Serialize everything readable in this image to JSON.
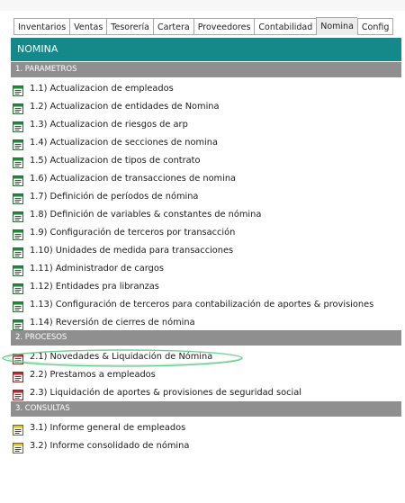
{
  "tabs": [
    {
      "label": "Inventarios",
      "active": false
    },
    {
      "label": "Ventas",
      "active": false
    },
    {
      "label": "Tesorería",
      "active": false
    },
    {
      "label": "Cartera",
      "active": false
    },
    {
      "label": "Proveedores",
      "active": false
    },
    {
      "label": "Contabilidad",
      "active": false
    },
    {
      "label": "Nomina",
      "active": true
    },
    {
      "label": "Config",
      "active": false
    }
  ],
  "header": {
    "title": "NOMINA"
  },
  "colors": {
    "header_bg": "#15898a",
    "section_bg": "#8f8f8f",
    "highlight_oval": "#3fbf6f"
  },
  "sections": [
    {
      "title": "1. PARAMETROS",
      "items": [
        {
          "label": "1.1) Actualizacion de empleados",
          "icon": "green-form-icon"
        },
        {
          "label": "1.2) Actualizacion de entidades de Nomina",
          "icon": "green-form-icon"
        },
        {
          "label": "1.3) Actualizacion de riesgos de arp",
          "icon": "green-form-icon"
        },
        {
          "label": "1.4) Actualizacion de secciones de nomina",
          "icon": "green-form-icon"
        },
        {
          "label": "1.5) Actualizacion de tipos de contrato",
          "icon": "green-form-icon"
        },
        {
          "label": "1.6) Actualizacion de transacciones de nomina",
          "icon": "green-form-icon"
        },
        {
          "label": "1.7) Definición de períodos de nómina",
          "icon": "green-form-icon"
        },
        {
          "label": "1.8) Definición de variables & constantes de nómina",
          "icon": "green-form-icon"
        },
        {
          "label": "1.9) Configuración de terceros por transacción",
          "icon": "green-form-icon"
        },
        {
          "label": "1.10) Unidades de medida para transacciones",
          "icon": "green-form-icon"
        },
        {
          "label": "1.11) Administrador de cargos",
          "icon": "green-form-icon"
        },
        {
          "label": "1.12) Entidades pra libranzas",
          "icon": "green-form-icon"
        },
        {
          "label": "1.13) Configuración de terceros para contabilización de aportes & provisiones",
          "icon": "green-form-icon"
        },
        {
          "label": "1.14) Reversión de cierres de nómina",
          "icon": "green-form-icon"
        }
      ]
    },
    {
      "title": "2. PROCESOS",
      "items": [
        {
          "label": "2.1) Novedades & Liquidación de Nómina",
          "icon": "red-form-icon"
        },
        {
          "label": "2.2) Prestamos a empleados",
          "icon": "red-form-icon"
        },
        {
          "label": "2.3) Liquidación de aportes & provisiones de seguridad social",
          "icon": "red-form-icon"
        }
      ]
    },
    {
      "title": "3. CONSULTAS",
      "items": [
        {
          "label": "3.1) Informe general de empleados",
          "icon": "yellow-form-icon"
        },
        {
          "label": "3.2) Informe consolidado de nómina",
          "icon": "yellow-form-icon"
        }
      ]
    }
  ]
}
